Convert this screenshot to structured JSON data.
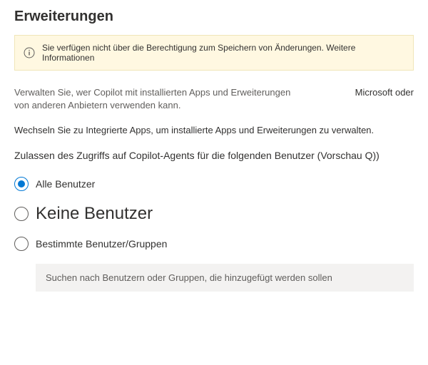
{
  "title": "Erweiterungen",
  "banner": {
    "text": "Sie verfügen nicht über die Berechtigung zum Speichern von Änderungen. Weitere Informationen"
  },
  "desc": {
    "main": "Verwalten Sie, wer Copilot mit installierten Apps und Erweiterungen von anderen Anbietern verwenden kann.",
    "side": "Microsoft oder"
  },
  "integratedAppsNote": "Wechseln Sie zu Integrierte Apps, um installierte Apps und Erweiterungen zu verwalten.",
  "accessLabel": "Zulassen des Zugriffs auf Copilot-Agents für die folgenden Benutzer (Vorschau Q))",
  "radios": {
    "all": "Alle Benutzer",
    "none": "Keine Benutzer",
    "specific": "Bestimmte Benutzer/Gruppen"
  },
  "searchPlaceholder": "Suchen nach Benutzern oder Gruppen, die hinzugefügt werden sollen"
}
